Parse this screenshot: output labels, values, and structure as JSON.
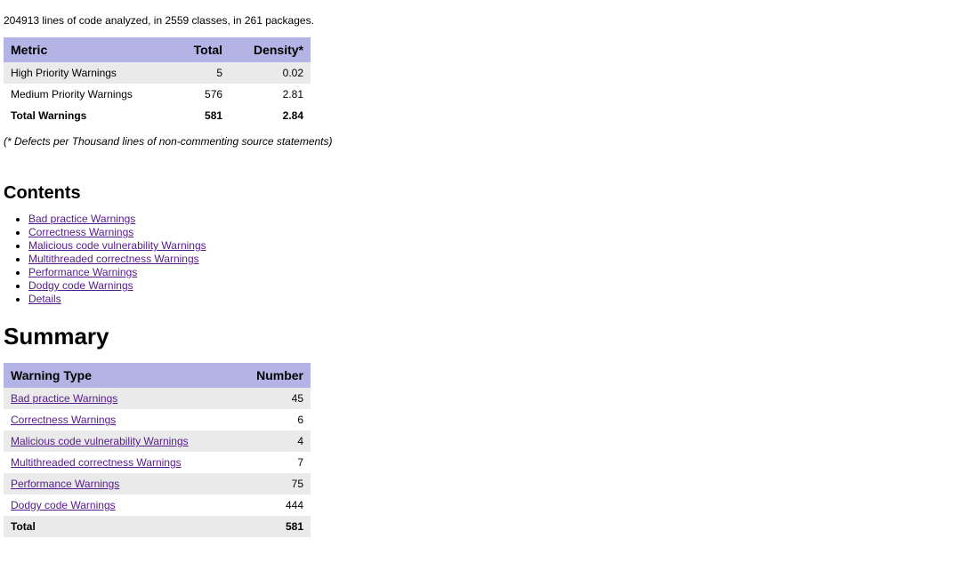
{
  "intro": "204913 lines of code analyzed, in 2559 classes, in 261 packages.",
  "metrics": {
    "headers": {
      "metric": "Metric",
      "total": "Total",
      "density": "Density*"
    },
    "rows": [
      {
        "metric": "High Priority Warnings",
        "total": "5",
        "density": "0.02"
      },
      {
        "metric": "Medium Priority Warnings",
        "total": "576",
        "density": "2.81"
      },
      {
        "metric": "Total Warnings",
        "total": "581",
        "density": "2.84"
      }
    ]
  },
  "footnote": "(* Defects per Thousand lines of non-commenting source statements)",
  "contents": {
    "heading": "Contents",
    "items": [
      "Bad practice Warnings",
      "Correctness Warnings",
      "Malicious code vulnerability Warnings",
      "Multithreaded correctness Warnings",
      "Performance Warnings",
      "Dodgy code Warnings",
      "Details"
    ]
  },
  "summary": {
    "heading": "Summary",
    "headers": {
      "type": "Warning Type",
      "number": "Number"
    },
    "rows": [
      {
        "type": "Bad practice Warnings",
        "number": "45"
      },
      {
        "type": "Correctness Warnings",
        "number": "6"
      },
      {
        "type": "Malicious code vulnerability Warnings",
        "number": "4"
      },
      {
        "type": "Multithreaded correctness Warnings",
        "number": "7"
      },
      {
        "type": "Performance Warnings",
        "number": "75"
      },
      {
        "type": "Dodgy code Warnings",
        "number": "444"
      }
    ],
    "total": {
      "label": "Total",
      "number": "581"
    }
  }
}
